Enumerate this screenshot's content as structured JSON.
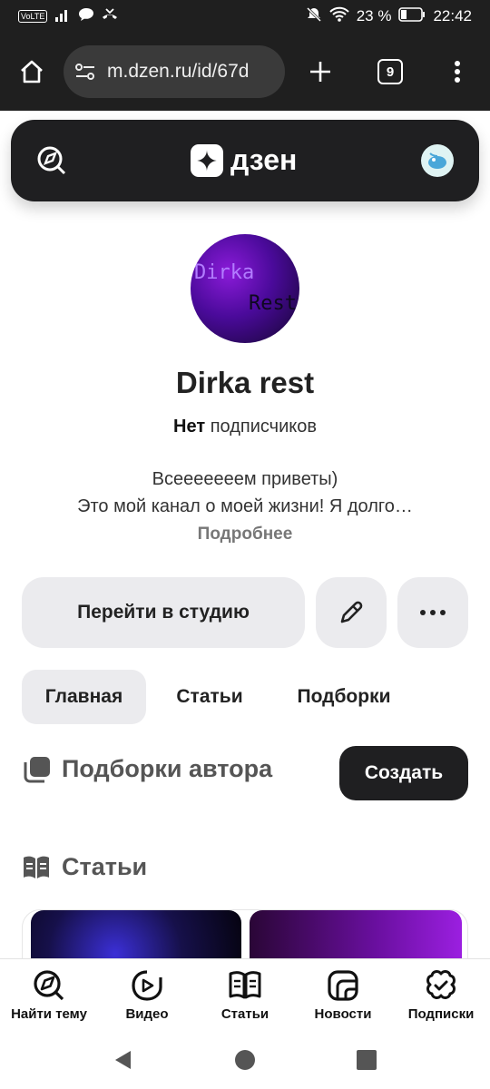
{
  "status_bar": {
    "network": "VoLTE",
    "battery": "23 %",
    "time": "22:42"
  },
  "browser": {
    "url": "m.dzen.ru/id/67d",
    "tab_count": "9"
  },
  "header": {
    "logo_text": "дзен"
  },
  "channel": {
    "name": "Dirka rest",
    "subs_bold": "Нет",
    "subs_rest": "подписчиков",
    "desc_line1": "Всееееееем приветы)",
    "desc_line2": "Это мой канал о моей жизни! Я долго…",
    "more": "Подробнее",
    "avatar_text1": "Dirka",
    "avatar_text2": "Rest"
  },
  "actions": {
    "studio": "Перейти в студию"
  },
  "tabs": [
    {
      "label": "Главная"
    },
    {
      "label": "Статьи"
    },
    {
      "label": "Подборки"
    }
  ],
  "sections": {
    "collections": "Подборки автора",
    "create": "Создать",
    "articles": "Статьи"
  },
  "bottom_nav": [
    {
      "label": "Найти тему",
      "icon": "compass-icon"
    },
    {
      "label": "Видео",
      "icon": "video-icon"
    },
    {
      "label": "Статьи",
      "icon": "articles-icon"
    },
    {
      "label": "Новости",
      "icon": "news-icon"
    },
    {
      "label": "Подписки",
      "icon": "subscriptions-icon"
    }
  ],
  "colors": {
    "dark": "#1f1f21",
    "chip": "#ebebee"
  }
}
